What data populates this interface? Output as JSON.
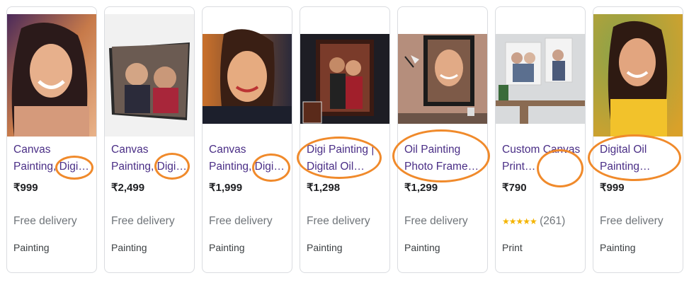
{
  "products": [
    {
      "title": "Canvas Painting, Digital...",
      "title_display": "Canvas Painting, Digi…",
      "price": "₹999",
      "delivery": "Free delivery",
      "category": "Painting",
      "image": "woman-portrait-painting"
    },
    {
      "title": "Canvas Painting, Digital...",
      "title_display": "Canvas Painting, Digi…",
      "price": "₹2,499",
      "delivery": "Free delivery",
      "category": "Painting",
      "image": "couple-canvas-print"
    },
    {
      "title": "Canvas Painting, Digital...",
      "title_display": "Canvas Painting, Digi…",
      "price": "₹1,999",
      "delivery": "Free delivery",
      "category": "Painting",
      "image": "woman-portrait-painting"
    },
    {
      "title": "Digi Painting | Digital Oil...",
      "title_display": "Digi Painting | Digital Oil…",
      "price": "₹1,298",
      "delivery": "Free delivery",
      "category": "Painting",
      "image": "couple-framed-portrait"
    },
    {
      "title": "Oil Painting Photo Frame...",
      "title_display": "Oil Painting Photo Frame…",
      "price": "₹1,299",
      "delivery": "Free delivery",
      "category": "Painting",
      "image": "framed-portrait-wall"
    },
    {
      "title": "Custom Canvas Print...",
      "title_display": "Custom Canvas Print…",
      "price": "₹790",
      "rating_stars": "★★★★★",
      "rating_count": "(261)",
      "rating_value": 4.5,
      "category": "Print",
      "image": "family-canvas-prints"
    },
    {
      "title": "Digital Oil Painting...",
      "title_display": "Digital Oil Painting…",
      "price": "₹999",
      "delivery": "Free delivery",
      "category": "Painting",
      "image": "woman-portrait-painting"
    }
  ],
  "colors": {
    "title": "#4a2e86",
    "annotation": "#f08a2b",
    "stars": "#f4b400"
  }
}
